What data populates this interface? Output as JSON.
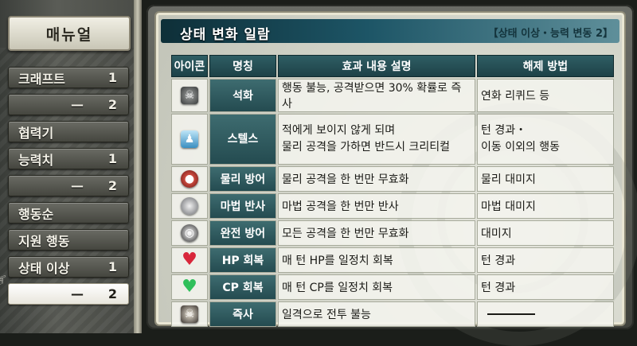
{
  "menu": {
    "title": "매뉴얼",
    "items": [
      {
        "label": "크래프트",
        "num": "1",
        "dash": ""
      },
      {
        "label": "",
        "num": "2",
        "dash": "—"
      },
      {
        "label": "협력기",
        "num": "",
        "dash": ""
      },
      {
        "label": "능력치",
        "num": "1",
        "dash": ""
      },
      {
        "label": "",
        "num": "2",
        "dash": "—"
      },
      {
        "label": "행동순",
        "num": "",
        "dash": ""
      },
      {
        "label": "지원 행동",
        "num": "",
        "dash": ""
      },
      {
        "label": "상태 이상",
        "num": "1",
        "dash": ""
      },
      {
        "label": "",
        "num": "2",
        "dash": "—"
      }
    ]
  },
  "page": {
    "title": "상태 변화 일람",
    "subtitle": "【상태 이상・능력 변동 2】"
  },
  "table": {
    "headers": [
      "아이콘",
      "명칭",
      "효과 내용 설명",
      "해제 방법"
    ],
    "rows": [
      {
        "icon": "petrify-skull-icon",
        "name": "석화",
        "desc": "행동 불능, 공격받으면 30% 확률로 즉사",
        "desc2": "",
        "remedy": "연화 리퀴드 등",
        "remedy2": ""
      },
      {
        "icon": "stealth-figure-icon",
        "name": "스텔스",
        "desc": "적에게 보이지 않게 되며",
        "desc2": "물리 공격을 가하면 반드시 크리티컬",
        "remedy": "턴 경과・",
        "remedy2": "이동 이외의 행동"
      },
      {
        "icon": "physical-shield-icon",
        "name": "물리 방어",
        "desc": "물리 공격을 한 번만 무효화",
        "desc2": "",
        "remedy": "물리 대미지",
        "remedy2": ""
      },
      {
        "icon": "magic-reflect-icon",
        "name": "마법 반사",
        "desc": "마법 공격을 한 번만 반사",
        "desc2": "",
        "remedy": "마법 대미지",
        "remedy2": ""
      },
      {
        "icon": "full-defense-icon",
        "name": "완전 방어",
        "desc": "모든 공격을 한 번만 무효화",
        "desc2": "",
        "remedy": "대미지",
        "remedy2": ""
      },
      {
        "icon": "hp-heart-icon",
        "name": "HP 회복",
        "desc": "매 턴 HP를 일정치 회복",
        "desc2": "",
        "remedy": "턴 경과",
        "remedy2": ""
      },
      {
        "icon": "cp-heart-icon",
        "name": "CP 회복",
        "desc": "매 턴 CP를 일정치 회복",
        "desc2": "",
        "remedy": "턴 경과",
        "remedy2": ""
      },
      {
        "icon": "instant-death-skull-icon",
        "name": "즉사",
        "desc": "일격으로 전투 불능",
        "desc2": "",
        "remedy": "",
        "remedy2": ""
      }
    ]
  }
}
